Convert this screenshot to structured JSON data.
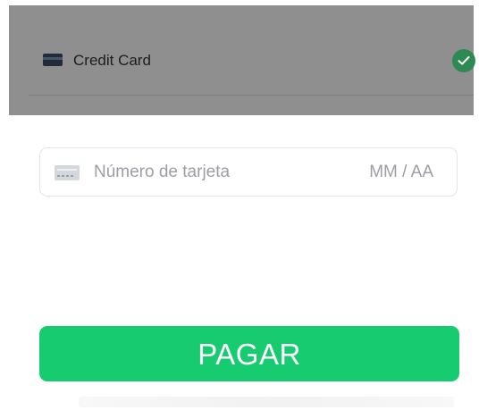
{
  "payment_method": {
    "label": "Credit Card",
    "card_icon": "credit-card-icon",
    "selected_icon": "check-circle-icon"
  },
  "card_input": {
    "card_number_placeholder": "Número de tarjeta",
    "expiry_placeholder": "MM / AA",
    "icon": "card-placeholder-icon"
  },
  "pay_button": {
    "label": "PAGAR"
  },
  "colors": {
    "overlay": "#8f8f8f",
    "check": "#2c8a52",
    "button": "#17cb70",
    "placeholder_text": "#9b9ea4"
  }
}
